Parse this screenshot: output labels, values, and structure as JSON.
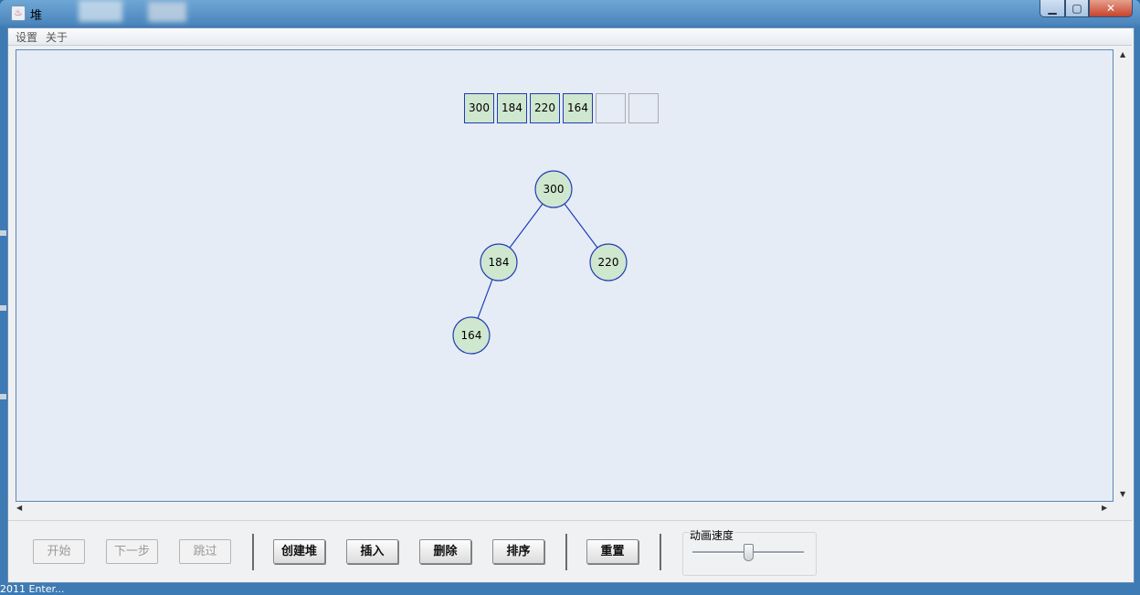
{
  "window": {
    "title": "堆",
    "controls": {
      "minimize": "▁",
      "maximize": "▢",
      "close": "✕"
    }
  },
  "menu": {
    "items": [
      "设置",
      "关于"
    ]
  },
  "array": {
    "cells": [
      "300",
      "184",
      "220",
      "164",
      "",
      ""
    ]
  },
  "tree": {
    "nodes": [
      "300",
      "184",
      "220",
      "164"
    ],
    "edges": [
      [
        "300",
        "184"
      ],
      [
        "300",
        "220"
      ],
      [
        "184",
        "164"
      ]
    ],
    "colors": {
      "node_fill": "#cfe6cf",
      "node_stroke": "#1f3db8",
      "edge": "#1f3db8"
    }
  },
  "toolbar": {
    "start_label": "开始",
    "next_label": "下一步",
    "skip_label": "跳过",
    "create_label": "创建堆",
    "insert_label": "插入",
    "delete_label": "删除",
    "sort_label": "排序",
    "reset_label": "重置",
    "speed_label": "动画速度",
    "speed_value": 0.5
  },
  "taskbar": {
    "text": "2011 Enter..."
  }
}
